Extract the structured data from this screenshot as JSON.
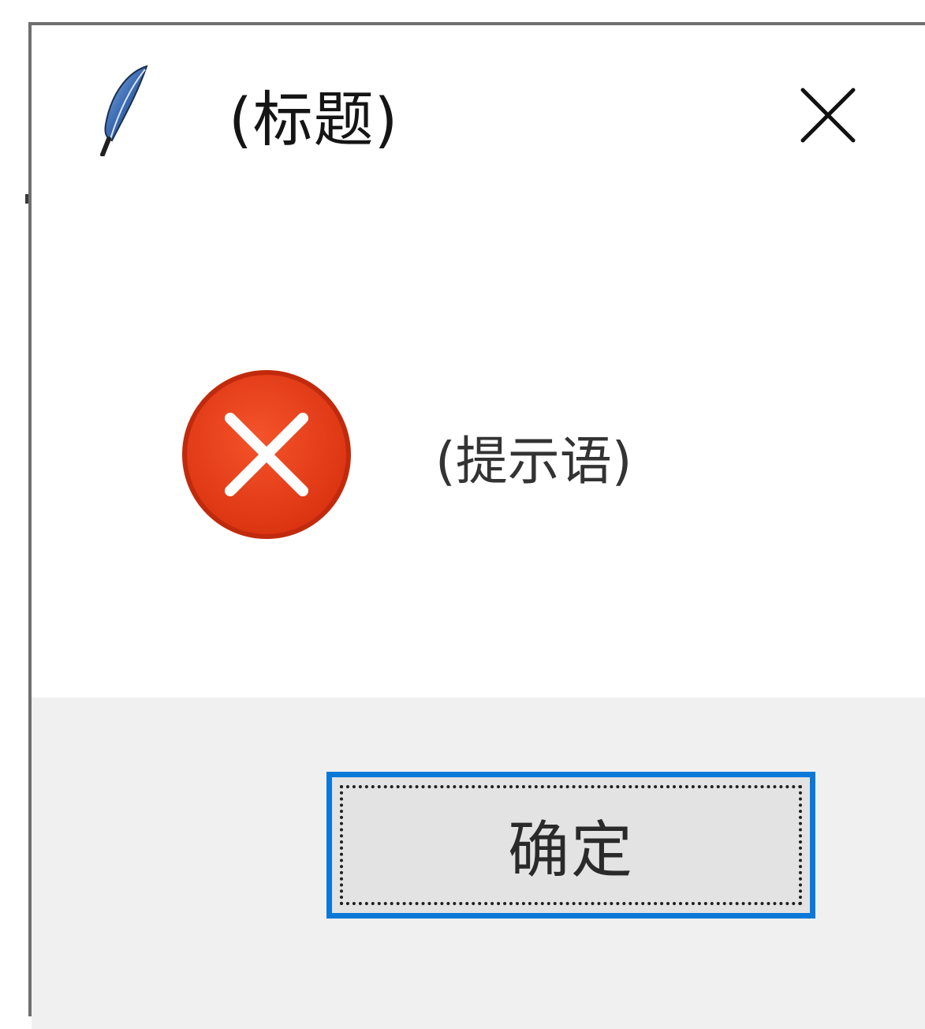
{
  "window": {
    "title": "(标题)",
    "app_icon": "feather-icon",
    "close_icon": "close-icon"
  },
  "content": {
    "icon": "error-icon",
    "icon_color": "#e8401c",
    "message": "(提示语)"
  },
  "footer": {
    "ok_label": "确定",
    "ok_border_color": "#0a78d7"
  }
}
